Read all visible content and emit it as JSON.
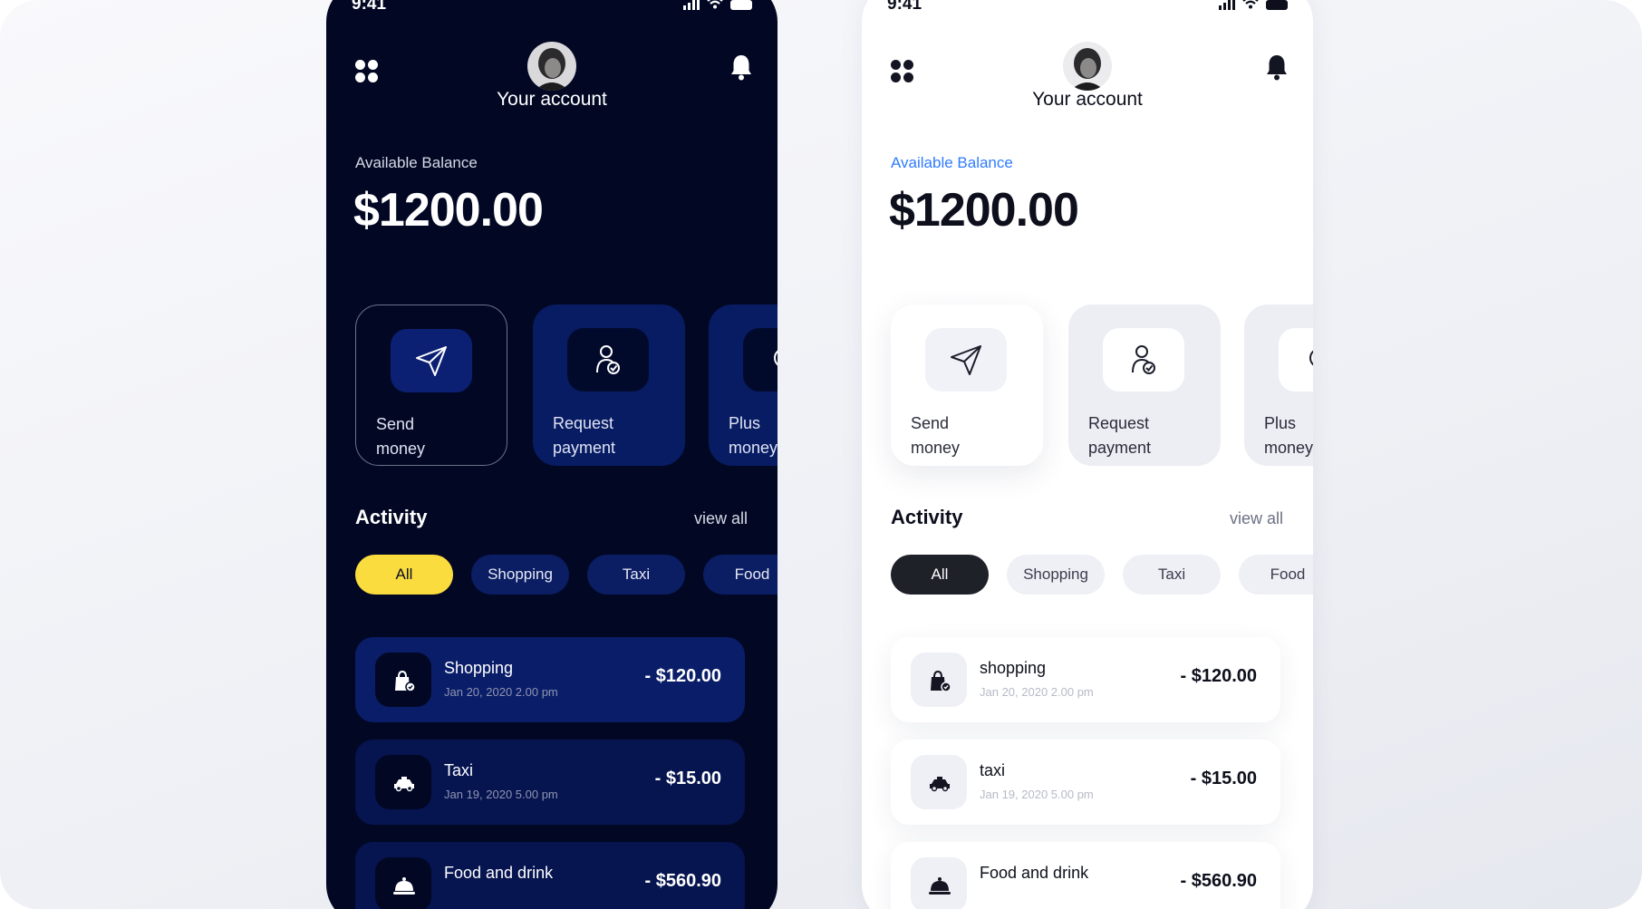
{
  "status_bar": {
    "time": "9:41"
  },
  "colors": {
    "dark_bg": "#020824",
    "dark_card": "#081c63",
    "accent_yellow": "#fadc3e",
    "accent_blue": "#2f7bff",
    "light_active_chip": "#1f2129"
  },
  "header": {
    "title": "Your account",
    "menu_icon": "grid-dots-icon",
    "notification_icon": "bell-icon"
  },
  "balance": {
    "label": "Available Balance",
    "amount": "$1200.00"
  },
  "actions": [
    {
      "label": "Send\nmoney",
      "icon": "paper-plane-icon"
    },
    {
      "label": "Request\npayment",
      "icon": "user-check-icon"
    },
    {
      "label": "Plus\nmoney",
      "icon": "plus-money-icon"
    }
  ],
  "activity": {
    "title": "Activity",
    "view_all": "view all",
    "filters": [
      "All",
      "Shopping",
      "Taxi",
      "Food"
    ],
    "active_filter": "All"
  },
  "dark_transactions": [
    {
      "name": "Shopping",
      "date": "Jan 20, 2020 2.00 pm",
      "amount": "- $120.00",
      "icon": "shopping-bag-icon"
    },
    {
      "name": "Taxi",
      "date": "Jan 19, 2020 5.00 pm",
      "amount": "- $15.00",
      "icon": "taxi-icon"
    },
    {
      "name": "Food and drink",
      "date": "",
      "amount": "- $560.90",
      "icon": "food-cloche-icon"
    }
  ],
  "light_transactions": [
    {
      "name": "shopping",
      "date": "Jan 20, 2020 2.00 pm",
      "amount": "- $120.00",
      "icon": "shopping-bag-icon"
    },
    {
      "name": "taxi",
      "date": "Jan 19, 2020 5.00 pm",
      "amount": "- $15.00",
      "icon": "taxi-icon"
    },
    {
      "name": "Food and drink",
      "date": "",
      "amount": "- $560.90",
      "icon": "food-cloche-icon"
    }
  ]
}
